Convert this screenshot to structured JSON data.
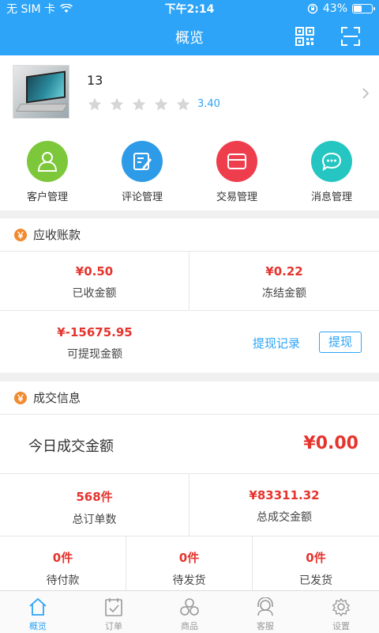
{
  "statusbar": {
    "carrier": "无 SIM 卡",
    "time": "下午2:14",
    "battery": "43%",
    "battery_level": 0.43
  },
  "navbar": {
    "title": "概览",
    "icons": [
      "qr-code-icon",
      "scan-icon"
    ]
  },
  "profile": {
    "name": "13",
    "rating": "3.40",
    "stars_filled": 0,
    "stars_total": 5
  },
  "quick_actions": [
    {
      "label": "客户管理",
      "icon": "user-icon",
      "color": "#7cc83a"
    },
    {
      "label": "评论管理",
      "icon": "edit-icon",
      "color": "#2d9be8"
    },
    {
      "label": "交易管理",
      "icon": "card-icon",
      "color": "#ee3d4c"
    },
    {
      "label": "消息管理",
      "icon": "chat-icon",
      "color": "#25c6c1"
    }
  ],
  "receivables": {
    "title": "应收账款",
    "badge": "￥",
    "received_value": "¥0.50",
    "received_label": "已收金额",
    "frozen_value": "¥0.22",
    "frozen_label": "冻结金额",
    "withdrawable_value": "¥-15675.95",
    "withdrawable_label": "可提现金额",
    "records_link": "提现记录",
    "withdraw_button": "提现"
  },
  "deals": {
    "title": "成交信息",
    "badge": "￥",
    "today_label": "今日成交金额",
    "today_value": "¥0.00",
    "orders_value": "568件",
    "orders_label": "总订单数",
    "total_value": "¥83311.32",
    "total_label": "总成交金额",
    "pending_pay_value": "0件",
    "pending_pay_label": "待付款",
    "pending_ship_value": "0件",
    "pending_ship_label": "待发货",
    "shipped_value": "0件",
    "shipped_label": "已发货"
  },
  "tabbar": [
    {
      "label": "概览",
      "icon": "home-icon",
      "active": true
    },
    {
      "label": "订单",
      "icon": "orders-icon",
      "active": false
    },
    {
      "label": "商品",
      "icon": "products-icon",
      "active": false
    },
    {
      "label": "客服",
      "icon": "support-icon",
      "active": false
    },
    {
      "label": "设置",
      "icon": "settings-icon",
      "active": false
    }
  ],
  "colors": {
    "primary": "#2da4f7",
    "accent_red": "#e5342e",
    "badge_orange": "#f28a2e"
  }
}
